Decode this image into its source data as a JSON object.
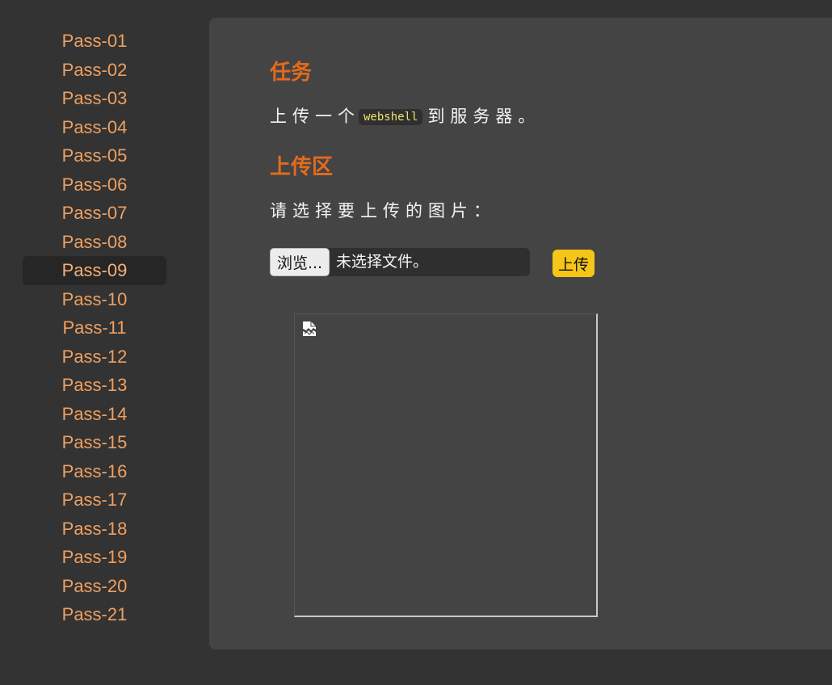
{
  "sidebar": {
    "items": [
      {
        "label": "Pass-01"
      },
      {
        "label": "Pass-02"
      },
      {
        "label": "Pass-03"
      },
      {
        "label": "Pass-04"
      },
      {
        "label": "Pass-05"
      },
      {
        "label": "Pass-06"
      },
      {
        "label": "Pass-07"
      },
      {
        "label": "Pass-08"
      },
      {
        "label": "Pass-09"
      },
      {
        "label": "Pass-10"
      },
      {
        "label": "Pass-11"
      },
      {
        "label": "Pass-12"
      },
      {
        "label": "Pass-13"
      },
      {
        "label": "Pass-14"
      },
      {
        "label": "Pass-15"
      },
      {
        "label": "Pass-16"
      },
      {
        "label": "Pass-17"
      },
      {
        "label": "Pass-18"
      },
      {
        "label": "Pass-19"
      },
      {
        "label": "Pass-20"
      },
      {
        "label": "Pass-21"
      }
    ],
    "active_label": "Pass-09"
  },
  "task": {
    "title": "任务",
    "text_before": "上传一个",
    "code": "webshell",
    "text_after": "到服务器。"
  },
  "upload": {
    "title": "上传区",
    "prompt": "请选择要上传的图片：",
    "browse_label": "浏览...",
    "file_status": "未选择文件。",
    "submit_label": "上传"
  },
  "preview": {
    "icon": "broken-image-icon"
  },
  "colors": {
    "accent": "#e36b1c",
    "link": "#f0a060",
    "button": "#f5c518",
    "code_text": "#f0e26a"
  }
}
